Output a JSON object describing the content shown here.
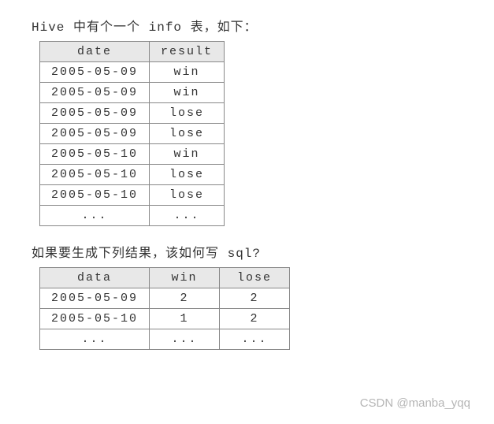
{
  "intro1": "Hive 中有个一个 info 表，如下：",
  "table1": {
    "headers": [
      "date",
      "result"
    ],
    "rows": [
      [
        "2005-05-09",
        "win"
      ],
      [
        "2005-05-09",
        "win"
      ],
      [
        "2005-05-09",
        "lose"
      ],
      [
        "2005-05-09",
        "lose"
      ],
      [
        "2005-05-10",
        "win"
      ],
      [
        "2005-05-10",
        "lose"
      ],
      [
        "2005-05-10",
        "lose"
      ],
      [
        "...",
        "..."
      ]
    ]
  },
  "intro2": "如果要生成下列结果，该如何写 sql?",
  "table2": {
    "headers": [
      "data",
      "win",
      "lose"
    ],
    "rows": [
      [
        "2005-05-09",
        "2",
        "2"
      ],
      [
        "2005-05-10",
        "1",
        "2"
      ],
      [
        "...",
        "...",
        "..."
      ]
    ]
  },
  "watermark": "CSDN @manba_yqq",
  "chart_data": [
    {
      "type": "table",
      "title": "info",
      "columns": [
        "date",
        "result"
      ],
      "rows": [
        [
          "2005-05-09",
          "win"
        ],
        [
          "2005-05-09",
          "win"
        ],
        [
          "2005-05-09",
          "lose"
        ],
        [
          "2005-05-09",
          "lose"
        ],
        [
          "2005-05-10",
          "win"
        ],
        [
          "2005-05-10",
          "lose"
        ],
        [
          "2005-05-10",
          "lose"
        ]
      ]
    },
    {
      "type": "table",
      "title": "result",
      "columns": [
        "data",
        "win",
        "lose"
      ],
      "rows": [
        [
          "2005-05-09",
          2,
          2
        ],
        [
          "2005-05-10",
          1,
          2
        ]
      ]
    }
  ]
}
